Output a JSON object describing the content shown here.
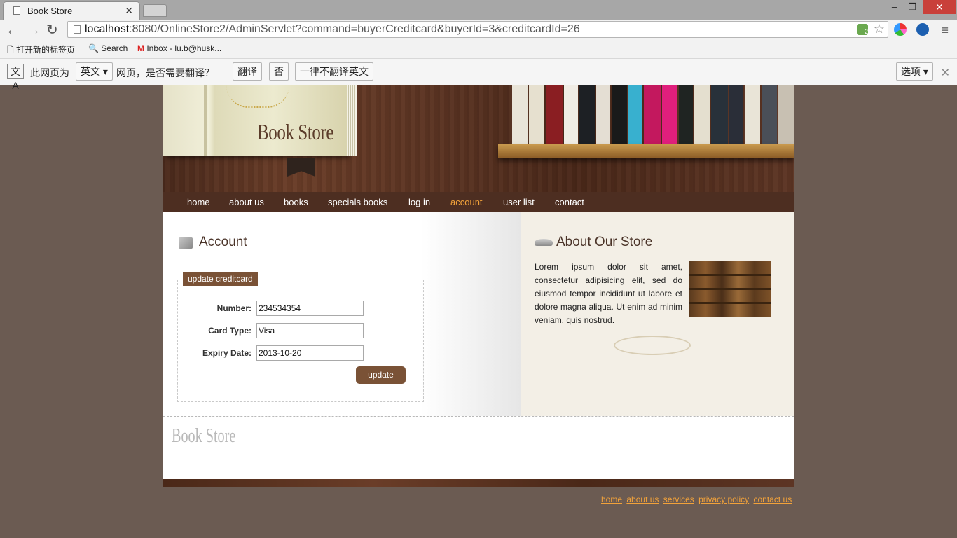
{
  "browser": {
    "tab_title": "Book Store",
    "url_host": "localhost",
    "url_rest": ":8080/OnlineStore2/AdminServlet?command=buyerCreditcard&buyerId=3&creditcardId=26",
    "bookmarks": [
      "打开新的标签页",
      "Search",
      "Inbox - lu.b@husk..."
    ],
    "translate": {
      "prefix": "此网页为",
      "language": "英文",
      "question": "网页，是否需要翻译？",
      "translate_btn": "翻译",
      "no_btn": "否",
      "never_btn": "一律不翻译英文",
      "options_btn": "选项"
    }
  },
  "site": {
    "logo": "Book Store",
    "nav": [
      "home",
      "about us",
      "books",
      "specials books",
      "log in",
      "account",
      "user list",
      "contact"
    ],
    "nav_active": "account",
    "account": {
      "heading": "Account",
      "legend": "update creditcard",
      "fields": [
        {
          "label": "Number:",
          "value": "234534354"
        },
        {
          "label": "Card Type:",
          "value": "Visa"
        },
        {
          "label": "Expiry Date:",
          "value": "2013-10-20"
        }
      ],
      "button": "update"
    },
    "about": {
      "heading": "About Our Store",
      "text": "Lorem ipsum dolor sit amet, consectetur adipisicing elit, sed do eiusmod tempor incididunt ut labore et dolore magna aliqua. Ut enim ad minim veniam, quis nostrud."
    },
    "footer": {
      "logo": "Book Store",
      "links": [
        "home",
        "about us",
        "services",
        "privacy policy",
        "contact us"
      ]
    }
  },
  "colors": {
    "page_bg": "#6b5b52",
    "nav_bg": "#4d2e21",
    "accent": "#f2a23a",
    "button": "#7a5236"
  }
}
